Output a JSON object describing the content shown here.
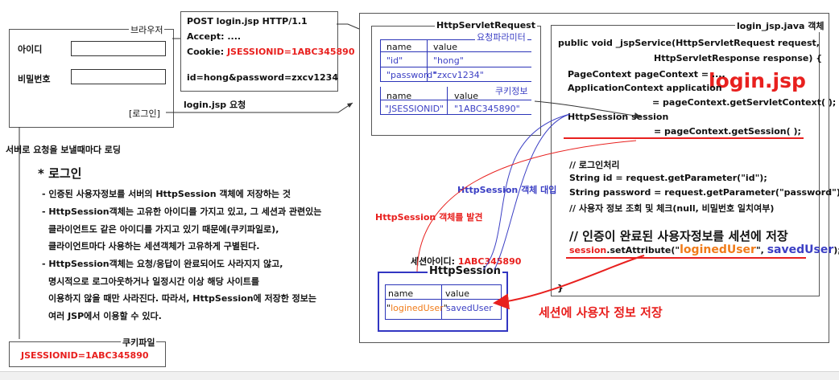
{
  "browser": {
    "title": "브라우저",
    "id_label": "아이디",
    "pw_label": "비밀번호",
    "id_value": "",
    "pw_value": "",
    "login_button": "[로그인]",
    "caption": "서버로 요청을 보낼때마다 로딩"
  },
  "http_request_text": {
    "line1": "POST  login.jsp  HTTP/1.1",
    "line2": "Accept: ....",
    "cookie_label": "Cookie: ",
    "cookie_value": "JSESSIONID=1ABC345890",
    "body": "id=hong&password=zxcv1234"
  },
  "request_arrow_label": "login.jsp 요청",
  "http_servlet_request": {
    "title": "HttpServletRequest",
    "params_title": "요청파라미터",
    "params_header": [
      "name",
      "value"
    ],
    "params_rows": [
      [
        "\"id\"",
        "\"hong\""
      ],
      [
        "\"password\"",
        "\"zxcv1234\""
      ]
    ],
    "cookie_title": "쿠키정보",
    "cookie_header": [
      "name",
      "value"
    ],
    "cookie_rows": [
      [
        "\"JSESSIONID\"",
        "\"1ABC345890\""
      ]
    ]
  },
  "jsp_object": {
    "title": "login_jsp.java 객체",
    "big_label": "login.jsp",
    "code": {
      "l1": "public void _jspService(HttpServletRequest request,",
      "l2": "HttpServletResponse response) {",
      "l3": "PageContext pageContext = ....",
      "l4": "ApplicationContext application",
      "l5": "= pageContext.getServletContext( );",
      "l6": "HttpSession session",
      "l7": "= pageContext.getSession( );",
      "l8": "// 로그인처리",
      "l9": "String id = request.getParameter(\"id\");",
      "l10": "String password = request.getParameter(\"password\");",
      "l11": "// 사용자 정보 조회 및 체크(null, 비밀번호 일치여부)",
      "l12": "// 인증이 완료된 사용자정보를 세션에 저장",
      "set_prefix": "session",
      "set_method": ".setAttribute(\"",
      "set_key": "loginedUser",
      "set_mid": "\", ",
      "set_val": "savedUser",
      "set_end": ");",
      "close": "}"
    }
  },
  "login_notes": {
    "heading": "* 로그인",
    "b1": "- 인증된 사용자정보를 서버의 HttpSession 객체에 저장하는 것",
    "b2_1": "- HttpSession객체는 고유한 아이디를 가지고 있고, 그 세션과 관련있는",
    "b2_2": "클라이언트도 같은 아이디를 가지고 있기 때문에(쿠키파일로),",
    "b2_3": "클라이언트마다 사용하는 세션객체가 고유하게 구별된다.",
    "b3_1": "- HttpSession객체는 요청/응답이 완료되어도 사라지지 않고,",
    "b3_2": "명시적으로 로그아웃하거나 일정시간 이상 해당 사이트를",
    "b3_3": "이용하지 않을 때만 사라진다. 따라서, HttpSession에 저장한 정보는",
    "b3_4": "여러 JSP에서 이용할 수 있다."
  },
  "cookie_file": {
    "title": "쿠키파일",
    "value": "JSESSIONID=1ABC345890"
  },
  "http_session": {
    "id_label": "세션아이디: ",
    "id_value": "1ABC345890",
    "title": "HttpSession",
    "header": [
      "name",
      "value"
    ],
    "row_key_quote_open": "\"",
    "row_key": "loginedUser",
    "row_key_quote_close": "\"",
    "row_value": "savedUser"
  },
  "annotations": {
    "found_session": "HttpSession 객체를 발견",
    "assign_session": "HttpSession 객체 대입",
    "store_user": "세션에 사용자 정보 저장"
  },
  "colors": {
    "red": "#e8201e",
    "blue": "#3b3fc4",
    "orange": "#f07b19"
  }
}
